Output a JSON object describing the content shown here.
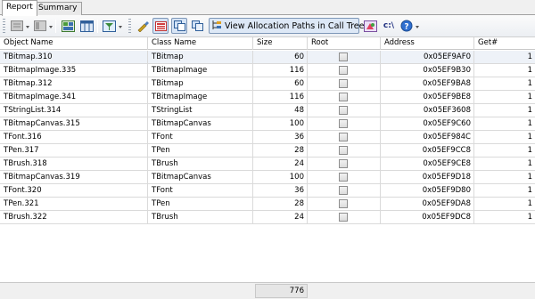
{
  "tabs": [
    {
      "label": "Report"
    },
    {
      "label": "Summary"
    }
  ],
  "toolbar": {
    "view_allocation_label": "View Allocation Paths in Call Tree",
    "icons": [
      "report-icon",
      "report-gray-icon",
      "grid-icon",
      "table-icon",
      "filter-icon",
      "paint-icon",
      "list-view-icon",
      "copy-icon",
      "copy2-icon",
      "tree-icon",
      "color-icon",
      "path-icon",
      "help-icon"
    ],
    "path_label": "c:\\"
  },
  "columns": [
    "Object Name",
    "Class Name",
    "Size",
    "Root",
    "Address",
    "Get#"
  ],
  "rows": [
    {
      "object": "TBitmap.310",
      "class": "TBitmap",
      "size": "60",
      "root": false,
      "address": "0x05EF9AF0",
      "get": "1"
    },
    {
      "object": "TBitmapImage.335",
      "class": "TBitmapImage",
      "size": "116",
      "root": false,
      "address": "0x05EF9B30",
      "get": "1"
    },
    {
      "object": "TBitmap.312",
      "class": "TBitmap",
      "size": "60",
      "root": false,
      "address": "0x05EF9BA8",
      "get": "1"
    },
    {
      "object": "TBitmapImage.341",
      "class": "TBitmapImage",
      "size": "116",
      "root": false,
      "address": "0x05EF9BE8",
      "get": "1"
    },
    {
      "object": "TStringList.314",
      "class": "TStringList",
      "size": "48",
      "root": false,
      "address": "0x05EF3608",
      "get": "1"
    },
    {
      "object": "TBitmapCanvas.315",
      "class": "TBitmapCanvas",
      "size": "100",
      "root": false,
      "address": "0x05EF9C60",
      "get": "1"
    },
    {
      "object": "TFont.316",
      "class": "TFont",
      "size": "36",
      "root": false,
      "address": "0x05EF984C",
      "get": "1"
    },
    {
      "object": "TPen.317",
      "class": "TPen",
      "size": "28",
      "root": false,
      "address": "0x05EF9CC8",
      "get": "1"
    },
    {
      "object": "TBrush.318",
      "class": "TBrush",
      "size": "24",
      "root": false,
      "address": "0x05EF9CE8",
      "get": "1"
    },
    {
      "object": "TBitmapCanvas.319",
      "class": "TBitmapCanvas",
      "size": "100",
      "root": false,
      "address": "0x05EF9D18",
      "get": "1"
    },
    {
      "object": "TFont.320",
      "class": "TFont",
      "size": "36",
      "root": false,
      "address": "0x05EF9D80",
      "get": "1"
    },
    {
      "object": "TPen.321",
      "class": "TPen",
      "size": "28",
      "root": false,
      "address": "0x05EF9DA8",
      "get": "1"
    },
    {
      "object": "TBrush.322",
      "class": "TBrush",
      "size": "24",
      "root": false,
      "address": "0x05EF9DC8",
      "get": "1"
    }
  ],
  "footer": {
    "total_size": "776"
  }
}
